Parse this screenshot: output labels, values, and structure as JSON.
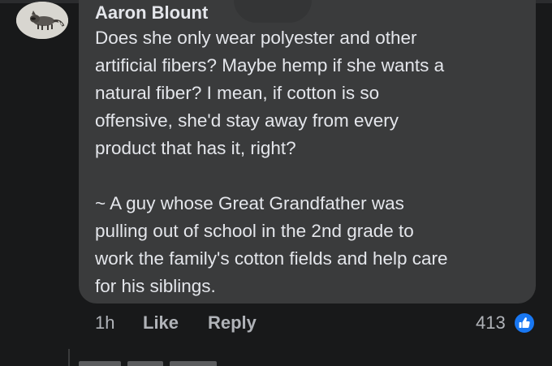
{
  "comment": {
    "author": "Aaron Blount",
    "text": "Does she only wear polyester and other\nartificial fibers? Maybe hemp if she wants a\nnatural fiber? I mean, if cotton is so\noffensive, she'd stay away from every\nproduct that has it, right?\n\n~ A guy whose Great Grandfather was\npulling out of school in the 2nd grade to\nwork the family's cotton fields and help care\nfor his siblings."
  },
  "actions": {
    "time": "1h",
    "like_label": "Like",
    "reply_label": "Reply",
    "reaction_count": "413"
  },
  "icons": {
    "avatar": "raccoon-avatar",
    "reaction": "thumbs-up-icon"
  },
  "colors": {
    "background": "#18191a",
    "bubble": "#3a3b3c",
    "text": "#e4e6eb",
    "secondary_text": "#b0b3b8",
    "like_blue": "#1877f2"
  }
}
